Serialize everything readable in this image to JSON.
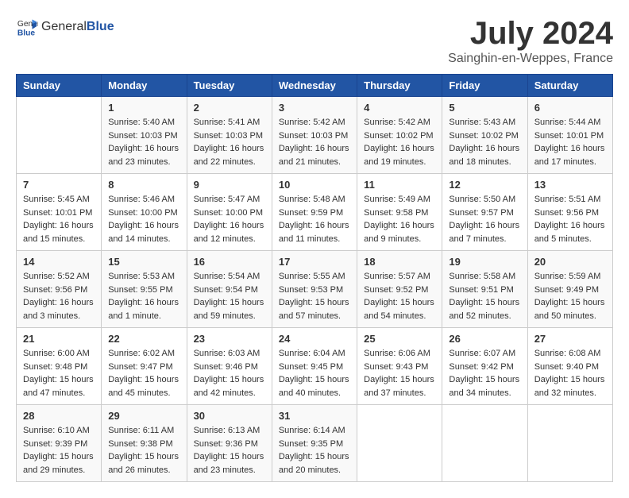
{
  "header": {
    "logo_general": "General",
    "logo_blue": "Blue",
    "title": "July 2024",
    "location": "Sainghin-en-Weppes, France"
  },
  "weekdays": [
    "Sunday",
    "Monday",
    "Tuesday",
    "Wednesday",
    "Thursday",
    "Friday",
    "Saturday"
  ],
  "weeks": [
    [
      {
        "day": "",
        "sunrise": "",
        "sunset": "",
        "daylight": ""
      },
      {
        "day": "1",
        "sunrise": "Sunrise: 5:40 AM",
        "sunset": "Sunset: 10:03 PM",
        "daylight": "Daylight: 16 hours and 23 minutes."
      },
      {
        "day": "2",
        "sunrise": "Sunrise: 5:41 AM",
        "sunset": "Sunset: 10:03 PM",
        "daylight": "Daylight: 16 hours and 22 minutes."
      },
      {
        "day": "3",
        "sunrise": "Sunrise: 5:42 AM",
        "sunset": "Sunset: 10:03 PM",
        "daylight": "Daylight: 16 hours and 21 minutes."
      },
      {
        "day": "4",
        "sunrise": "Sunrise: 5:42 AM",
        "sunset": "Sunset: 10:02 PM",
        "daylight": "Daylight: 16 hours and 19 minutes."
      },
      {
        "day": "5",
        "sunrise": "Sunrise: 5:43 AM",
        "sunset": "Sunset: 10:02 PM",
        "daylight": "Daylight: 16 hours and 18 minutes."
      },
      {
        "day": "6",
        "sunrise": "Sunrise: 5:44 AM",
        "sunset": "Sunset: 10:01 PM",
        "daylight": "Daylight: 16 hours and 17 minutes."
      }
    ],
    [
      {
        "day": "7",
        "sunrise": "Sunrise: 5:45 AM",
        "sunset": "Sunset: 10:01 PM",
        "daylight": "Daylight: 16 hours and 15 minutes."
      },
      {
        "day": "8",
        "sunrise": "Sunrise: 5:46 AM",
        "sunset": "Sunset: 10:00 PM",
        "daylight": "Daylight: 16 hours and 14 minutes."
      },
      {
        "day": "9",
        "sunrise": "Sunrise: 5:47 AM",
        "sunset": "Sunset: 10:00 PM",
        "daylight": "Daylight: 16 hours and 12 minutes."
      },
      {
        "day": "10",
        "sunrise": "Sunrise: 5:48 AM",
        "sunset": "Sunset: 9:59 PM",
        "daylight": "Daylight: 16 hours and 11 minutes."
      },
      {
        "day": "11",
        "sunrise": "Sunrise: 5:49 AM",
        "sunset": "Sunset: 9:58 PM",
        "daylight": "Daylight: 16 hours and 9 minutes."
      },
      {
        "day": "12",
        "sunrise": "Sunrise: 5:50 AM",
        "sunset": "Sunset: 9:57 PM",
        "daylight": "Daylight: 16 hours and 7 minutes."
      },
      {
        "day": "13",
        "sunrise": "Sunrise: 5:51 AM",
        "sunset": "Sunset: 9:56 PM",
        "daylight": "Daylight: 16 hours and 5 minutes."
      }
    ],
    [
      {
        "day": "14",
        "sunrise": "Sunrise: 5:52 AM",
        "sunset": "Sunset: 9:56 PM",
        "daylight": "Daylight: 16 hours and 3 minutes."
      },
      {
        "day": "15",
        "sunrise": "Sunrise: 5:53 AM",
        "sunset": "Sunset: 9:55 PM",
        "daylight": "Daylight: 16 hours and 1 minute."
      },
      {
        "day": "16",
        "sunrise": "Sunrise: 5:54 AM",
        "sunset": "Sunset: 9:54 PM",
        "daylight": "Daylight: 15 hours and 59 minutes."
      },
      {
        "day": "17",
        "sunrise": "Sunrise: 5:55 AM",
        "sunset": "Sunset: 9:53 PM",
        "daylight": "Daylight: 15 hours and 57 minutes."
      },
      {
        "day": "18",
        "sunrise": "Sunrise: 5:57 AM",
        "sunset": "Sunset: 9:52 PM",
        "daylight": "Daylight: 15 hours and 54 minutes."
      },
      {
        "day": "19",
        "sunrise": "Sunrise: 5:58 AM",
        "sunset": "Sunset: 9:51 PM",
        "daylight": "Daylight: 15 hours and 52 minutes."
      },
      {
        "day": "20",
        "sunrise": "Sunrise: 5:59 AM",
        "sunset": "Sunset: 9:49 PM",
        "daylight": "Daylight: 15 hours and 50 minutes."
      }
    ],
    [
      {
        "day": "21",
        "sunrise": "Sunrise: 6:00 AM",
        "sunset": "Sunset: 9:48 PM",
        "daylight": "Daylight: 15 hours and 47 minutes."
      },
      {
        "day": "22",
        "sunrise": "Sunrise: 6:02 AM",
        "sunset": "Sunset: 9:47 PM",
        "daylight": "Daylight: 15 hours and 45 minutes."
      },
      {
        "day": "23",
        "sunrise": "Sunrise: 6:03 AM",
        "sunset": "Sunset: 9:46 PM",
        "daylight": "Daylight: 15 hours and 42 minutes."
      },
      {
        "day": "24",
        "sunrise": "Sunrise: 6:04 AM",
        "sunset": "Sunset: 9:45 PM",
        "daylight": "Daylight: 15 hours and 40 minutes."
      },
      {
        "day": "25",
        "sunrise": "Sunrise: 6:06 AM",
        "sunset": "Sunset: 9:43 PM",
        "daylight": "Daylight: 15 hours and 37 minutes."
      },
      {
        "day": "26",
        "sunrise": "Sunrise: 6:07 AM",
        "sunset": "Sunset: 9:42 PM",
        "daylight": "Daylight: 15 hours and 34 minutes."
      },
      {
        "day": "27",
        "sunrise": "Sunrise: 6:08 AM",
        "sunset": "Sunset: 9:40 PM",
        "daylight": "Daylight: 15 hours and 32 minutes."
      }
    ],
    [
      {
        "day": "28",
        "sunrise": "Sunrise: 6:10 AM",
        "sunset": "Sunset: 9:39 PM",
        "daylight": "Daylight: 15 hours and 29 minutes."
      },
      {
        "day": "29",
        "sunrise": "Sunrise: 6:11 AM",
        "sunset": "Sunset: 9:38 PM",
        "daylight": "Daylight: 15 hours and 26 minutes."
      },
      {
        "day": "30",
        "sunrise": "Sunrise: 6:13 AM",
        "sunset": "Sunset: 9:36 PM",
        "daylight": "Daylight: 15 hours and 23 minutes."
      },
      {
        "day": "31",
        "sunrise": "Sunrise: 6:14 AM",
        "sunset": "Sunset: 9:35 PM",
        "daylight": "Daylight: 15 hours and 20 minutes."
      },
      {
        "day": "",
        "sunrise": "",
        "sunset": "",
        "daylight": ""
      },
      {
        "day": "",
        "sunrise": "",
        "sunset": "",
        "daylight": ""
      },
      {
        "day": "",
        "sunrise": "",
        "sunset": "",
        "daylight": ""
      }
    ]
  ]
}
